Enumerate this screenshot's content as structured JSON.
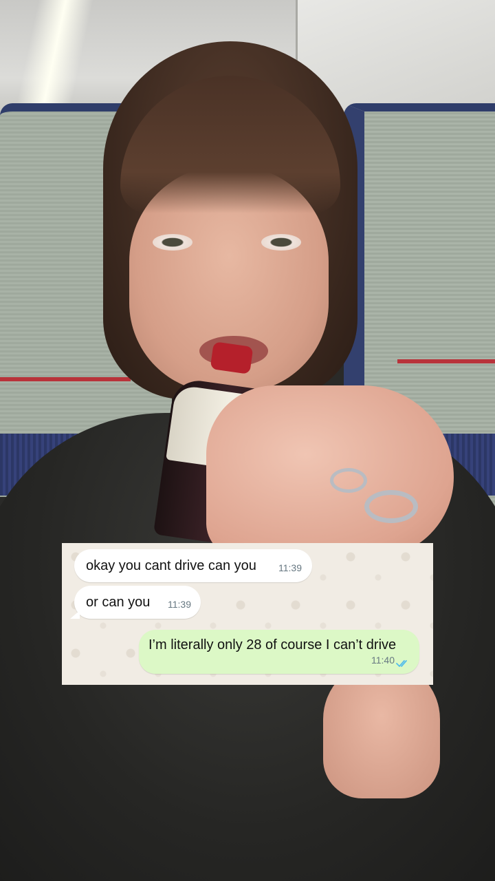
{
  "chat": {
    "messages": [
      {
        "direction": "incoming",
        "text": "okay you cant drive can you",
        "time": "11:39"
      },
      {
        "direction": "incoming",
        "text": "or can you",
        "time": "11:39"
      },
      {
        "direction": "outgoing",
        "text": "I’m literally only 28 of course I can’t drive",
        "time": "11:40",
        "status": "read"
      }
    ],
    "colors": {
      "incoming_bubble": "#ffffff",
      "outgoing_bubble": "#dcf8c6",
      "wallpaper": "#f1ece4",
      "read_ticks": "#53bdeb"
    },
    "read_icon": "double-check-icon"
  }
}
